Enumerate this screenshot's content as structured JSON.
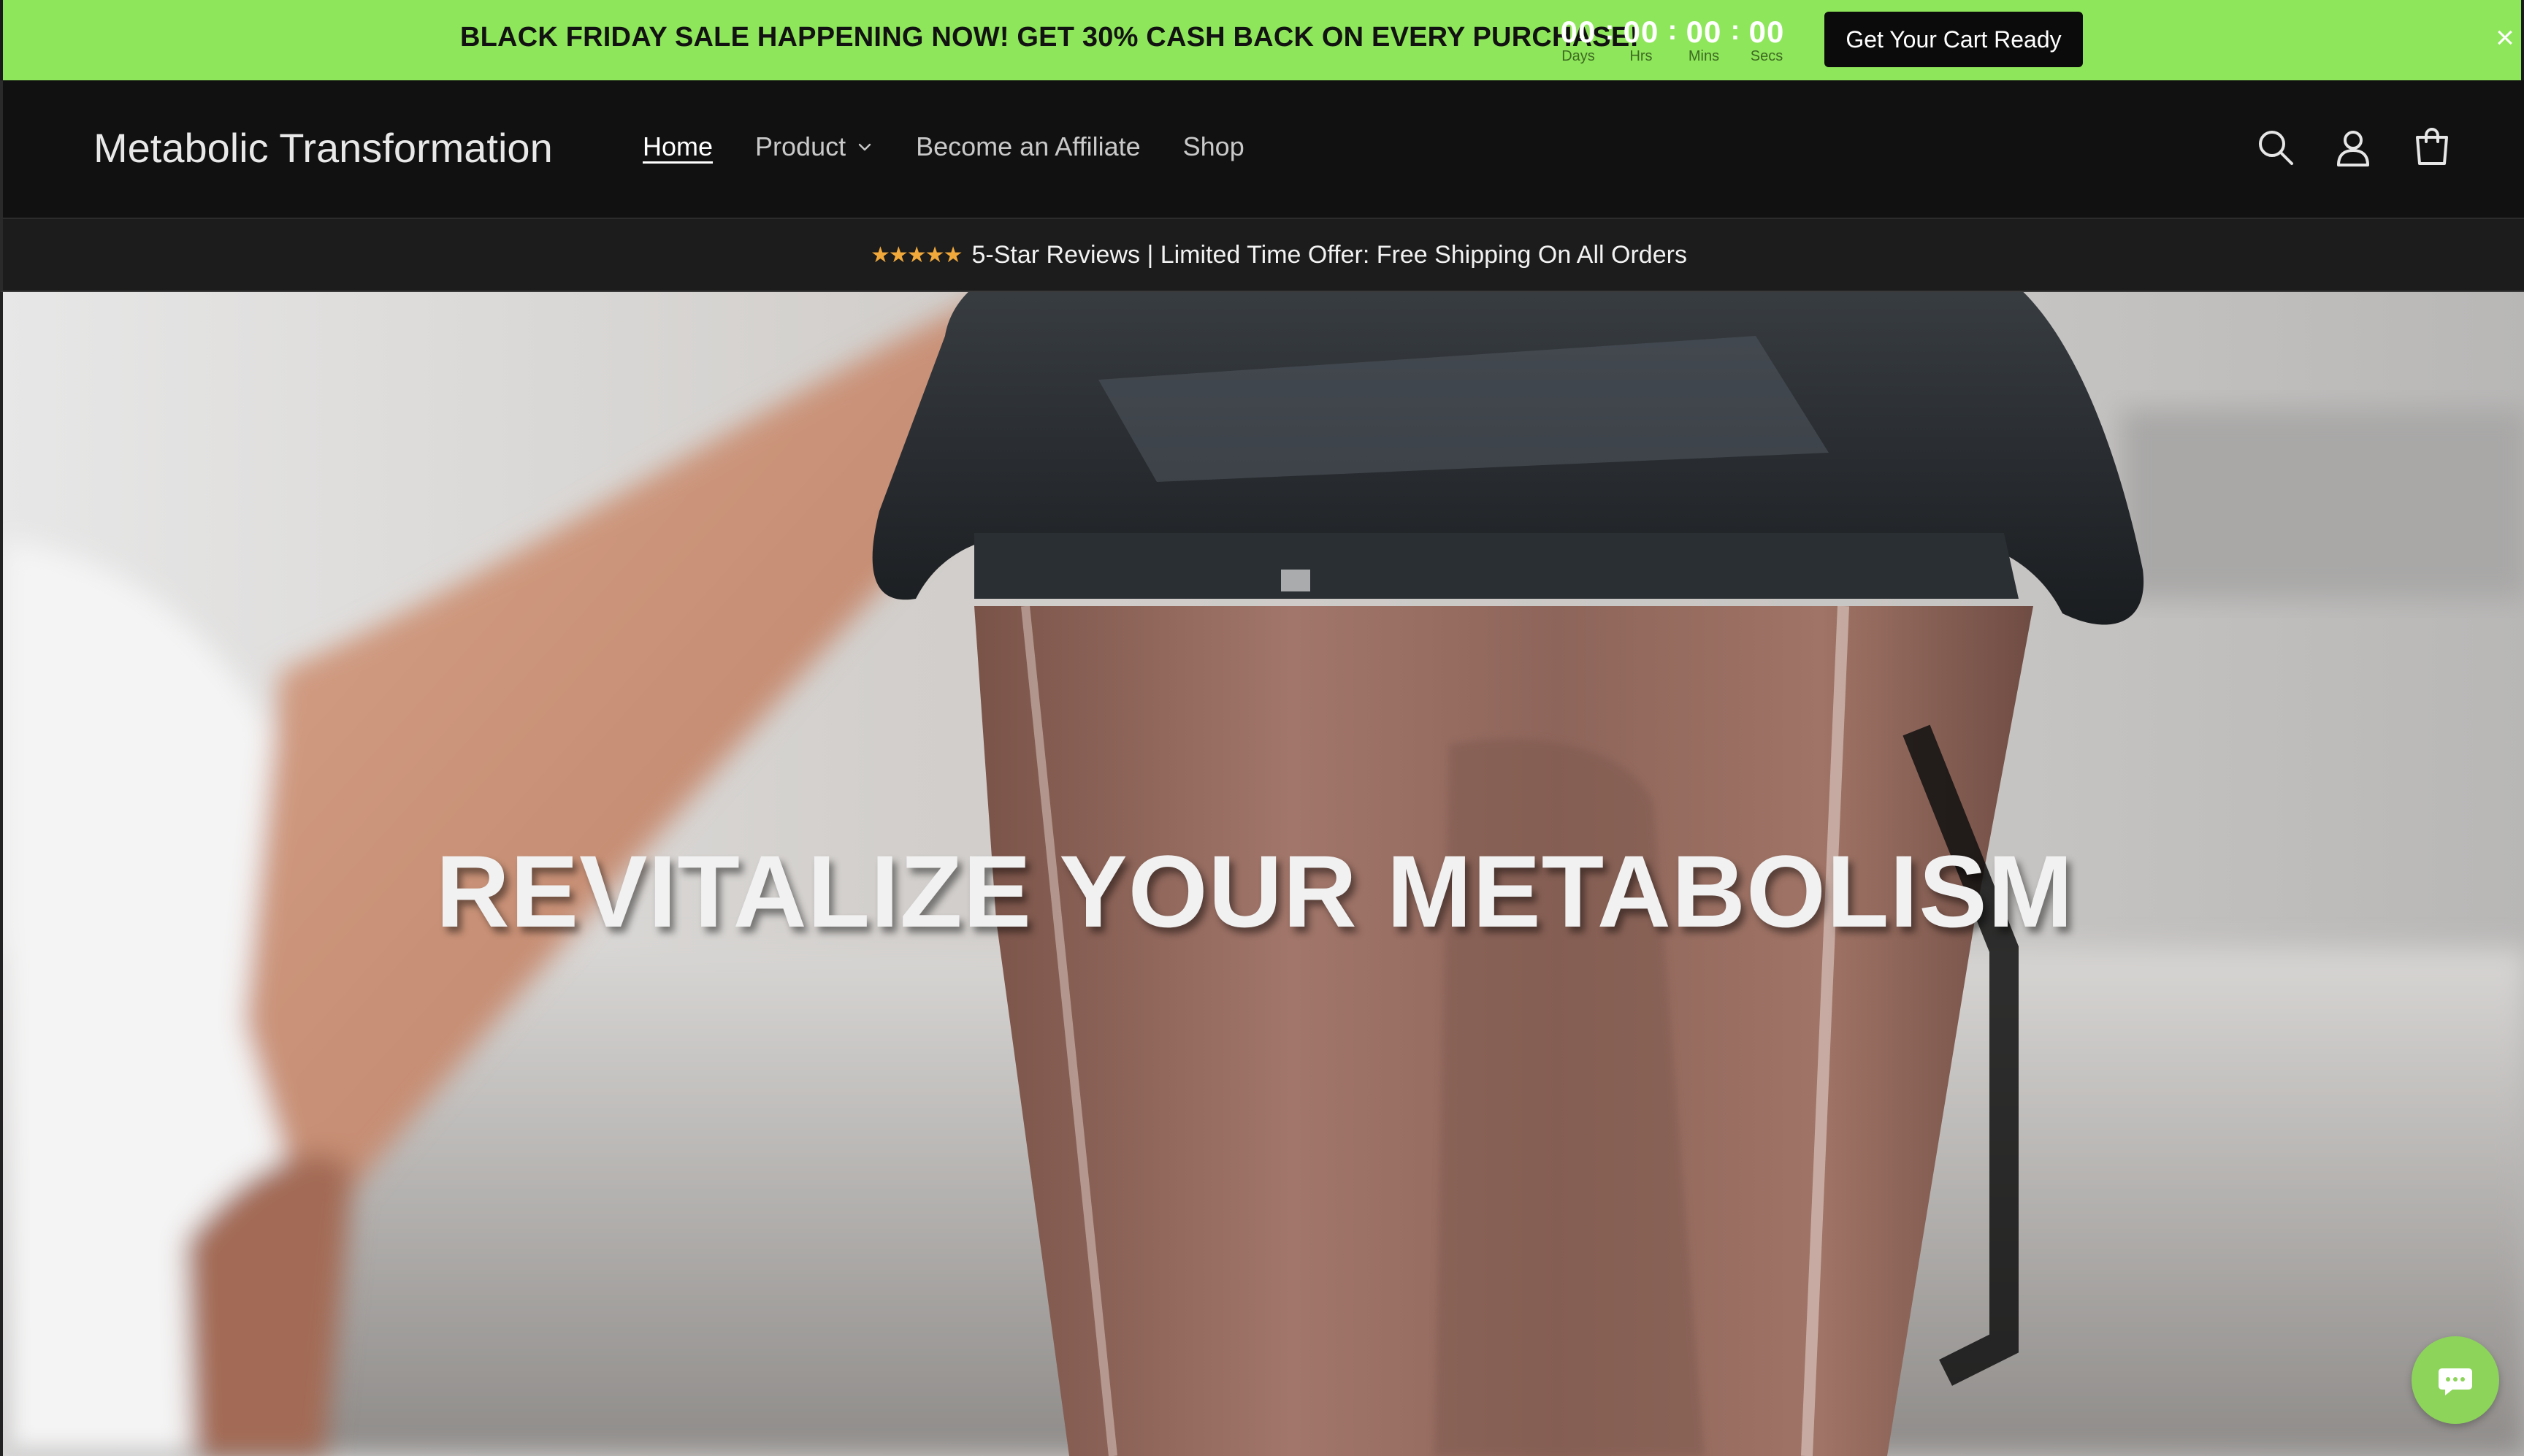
{
  "promo": {
    "message": "BLACK FRIDAY SALE HAPPENING NOW! GET 30% CASH BACK ON EVERY PURCHASE!",
    "countdown": [
      {
        "value": "00",
        "label": "Days"
      },
      {
        "value": "00",
        "label": "Hrs"
      },
      {
        "value": "00",
        "label": "Mins"
      },
      {
        "value": "00",
        "label": "Secs"
      }
    ],
    "separator": ":",
    "cta_label": "Get Your Cart Ready",
    "close_glyph": "×",
    "background_color": "#8ee65a"
  },
  "header": {
    "logo": "Metabolic Transformation",
    "nav": [
      {
        "label": "Home",
        "active": true
      },
      {
        "label": "Product",
        "has_dropdown": true
      },
      {
        "label": "Become an Affiliate"
      },
      {
        "label": "Shop"
      }
    ],
    "icons": [
      "search-icon",
      "account-icon",
      "cart-icon"
    ]
  },
  "reviews_bar": {
    "stars": "★★★★★",
    "text": "5-Star Reviews | Limited Time Offer: Free Shipping On All Orders",
    "star_color": "#f2a93b"
  },
  "hero": {
    "title": "REVITALIZE YOUR METABOLISM"
  },
  "chat": {
    "icon": "chat-icon",
    "color": "#8cd45a"
  }
}
